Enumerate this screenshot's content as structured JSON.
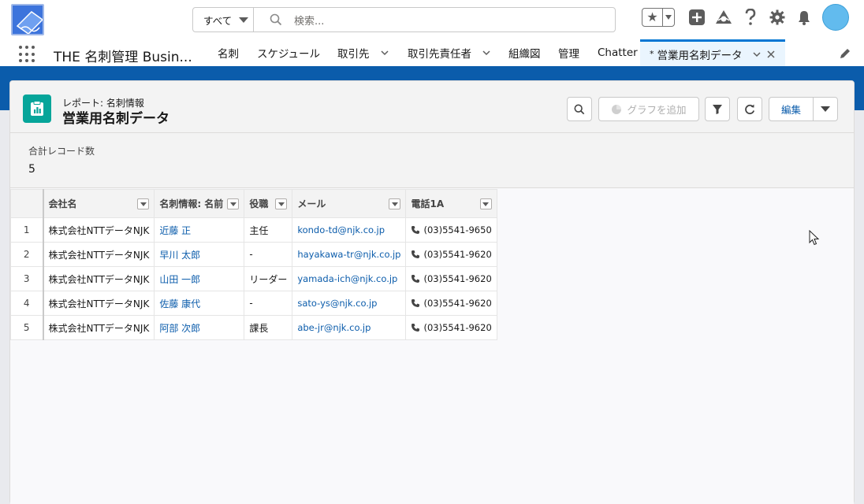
{
  "header": {
    "search_scope": "すべて",
    "search_placeholder": "検索...",
    "icons": [
      "star-icon",
      "add-icon",
      "trailhead-icon",
      "help-icon",
      "gear-icon",
      "bell-icon",
      "avatar"
    ]
  },
  "nav": {
    "app_name": "THE 名刺管理 Busin...",
    "items": [
      {
        "label": "名刺",
        "dropdown": false
      },
      {
        "label": "スケジュール",
        "dropdown": false
      },
      {
        "label": "取引先",
        "dropdown": true
      },
      {
        "label": "取引先責任者",
        "dropdown": true
      },
      {
        "label": "組織図",
        "dropdown": false
      },
      {
        "label": "管理",
        "dropdown": false
      },
      {
        "label": "Chatter",
        "dropdown": false
      }
    ],
    "active_tab": {
      "prefix": "*",
      "label": "営業用名刺データ"
    }
  },
  "report": {
    "type_label": "レポート: 名刺情報",
    "title": "営業用名刺データ",
    "add_chart_label": "グラフを追加",
    "edit_label": "編集"
  },
  "summary": {
    "label": "合計レコード数",
    "value": "5"
  },
  "table": {
    "columns": [
      "会社名",
      "名刺情報: 名前",
      "役職",
      "メール",
      "電話1A"
    ],
    "rows": [
      {
        "n": "1",
        "company": "株式会社NTTデータNJK",
        "name": "近藤 正",
        "title": "主任",
        "email": "kondo-td@njk.co.jp",
        "phone": "(03)5541-9650"
      },
      {
        "n": "2",
        "company": "株式会社NTTデータNJK",
        "name": "早川 太郎",
        "title": "-",
        "email": "hayakawa-tr@njk.co.jp",
        "phone": "(03)5541-9620"
      },
      {
        "n": "3",
        "company": "株式会社NTTデータNJK",
        "name": "山田 一郎",
        "title": "リーダー",
        "email": "yamada-ich@njk.co.jp",
        "phone": "(03)5541-9620"
      },
      {
        "n": "4",
        "company": "株式会社NTTデータNJK",
        "name": "佐藤 康代",
        "title": "-",
        "email": "sato-ys@njk.co.jp",
        "phone": "(03)5541-9620"
      },
      {
        "n": "5",
        "company": "株式会社NTTデータNJK",
        "name": "阿部 次郎",
        "title": "課長",
        "email": "abe-jr@njk.co.jp",
        "phone": "(03)5541-9620"
      }
    ]
  },
  "colors": {
    "brand_blue": "#0b5cab",
    "active_tab_bg": "#eaf5fe",
    "link": "#0b5cab",
    "report_icon": "#06a59a"
  }
}
